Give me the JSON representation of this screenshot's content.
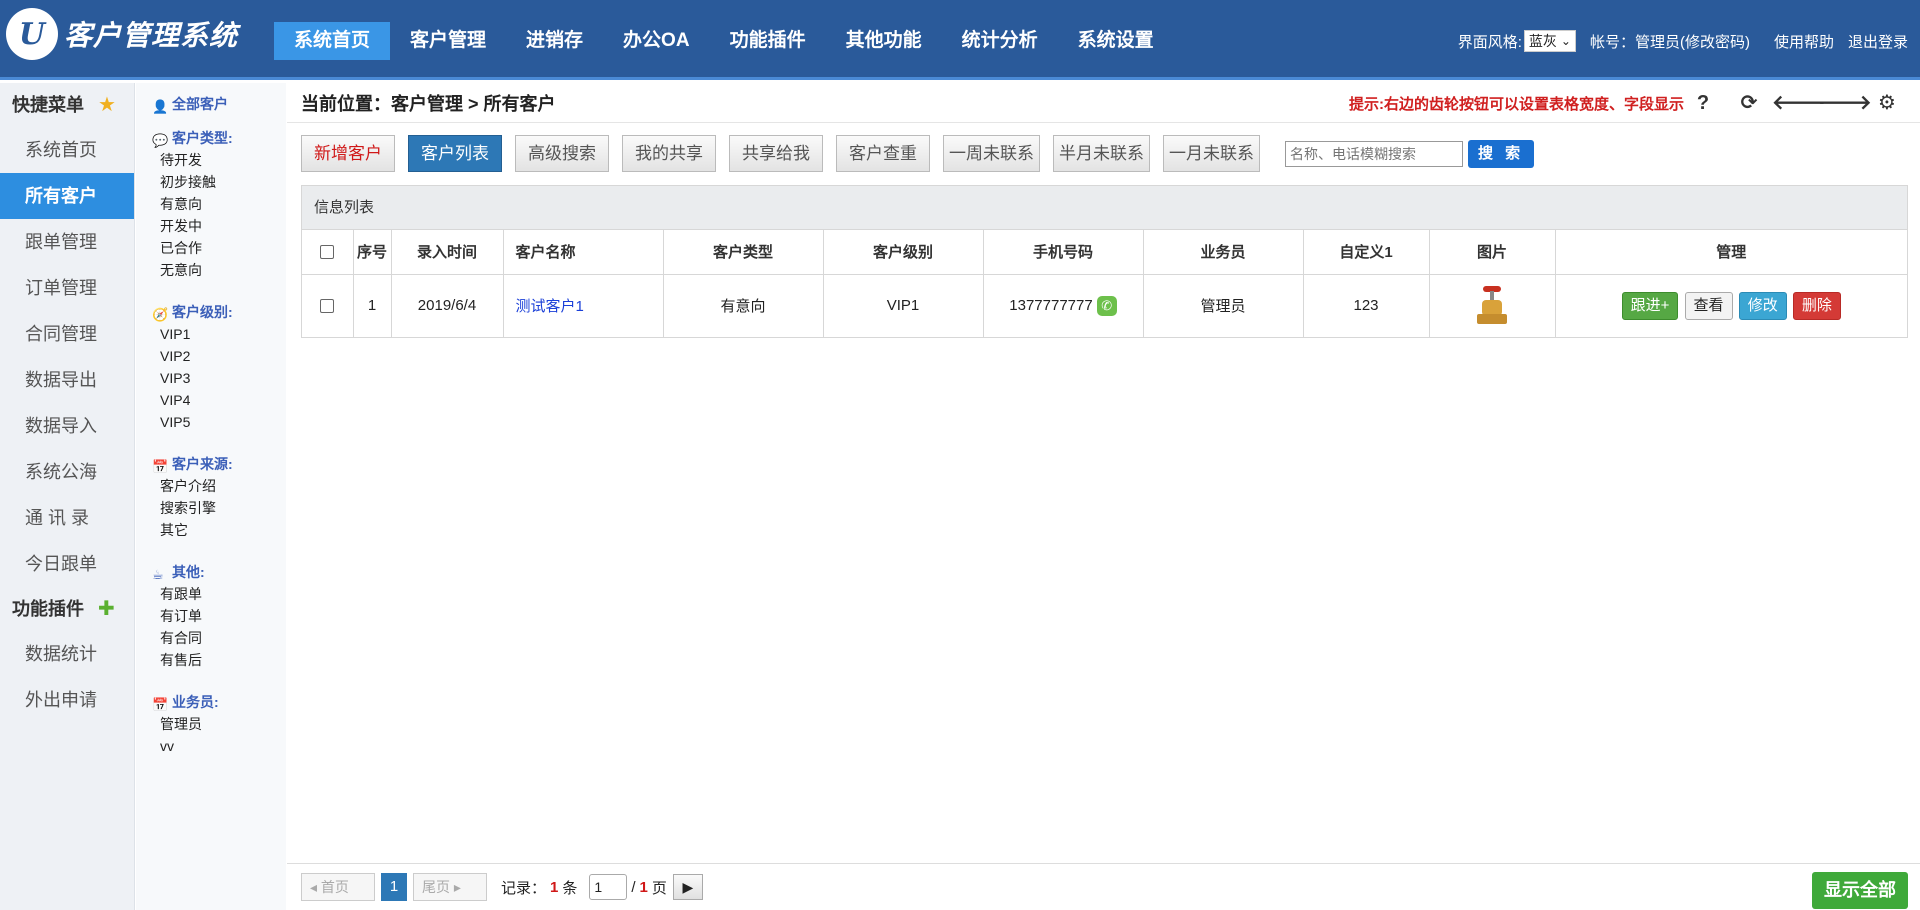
{
  "app": {
    "logo_letter": "U",
    "title": "客户管理系统"
  },
  "topnav": [
    "系统首页",
    "客户管理",
    "进销存",
    "办公OA",
    "功能插件",
    "其他功能",
    "统计分析",
    "系统设置"
  ],
  "topright": {
    "style_label": "界面风格:",
    "style_value": "蓝灰",
    "account": "帐号：管理员(修改密码)",
    "help": "使用帮助",
    "logout": "退出登录"
  },
  "leftmenu": {
    "quick_title": "快捷菜单",
    "items": [
      "系统首页",
      "所有客户",
      "跟单管理",
      "订单管理",
      "合同管理",
      "数据导出",
      "数据导入",
      "系统公海",
      "通 讯 录",
      "今日跟单"
    ],
    "plugin_title": "功能插件",
    "plugin_items": [
      "数据统计",
      "外出申请"
    ]
  },
  "categories": {
    "all": "全部客户",
    "type_title": "客户类型:",
    "types": [
      "待开发",
      "初步接触",
      "有意向",
      "开发中",
      "已合作",
      "无意向"
    ],
    "level_title": "客户级别:",
    "levels": [
      "VIP1",
      "VIP2",
      "VIP3",
      "VIP4",
      "VIP5"
    ],
    "source_title": "客户来源:",
    "sources": [
      "客户介绍",
      "搜索引擎",
      "其它"
    ],
    "other_title": "其他:",
    "others": [
      "有跟单",
      "有订单",
      "有合同",
      "有售后"
    ],
    "sales_title": "业务员:",
    "sales": [
      "管理员",
      "vv"
    ]
  },
  "breadcrumb": "当前位置：客户管理 > 所有客户",
  "hint": "提示:右边的齿轮按钮可以设置表格宽度、字段显示",
  "tools": [
    "?",
    "⟳",
    "🡐",
    "🡒",
    "⚙"
  ],
  "buttons": [
    "新增客户",
    "客户列表",
    "高级搜索",
    "我的共享",
    "共享给我",
    "客户查重",
    "一周未联系",
    "半月未联系",
    "一月未联系"
  ],
  "search": {
    "placeholder": "名称、电话模糊搜索",
    "button": "搜 索"
  },
  "list": {
    "title": "信息列表",
    "columns": [
      "序号",
      "录入时间",
      "客户名称",
      "客户类型",
      "客户级别",
      "手机号码",
      "业务员",
      "自定义1",
      "图片",
      "管理"
    ],
    "rows": [
      {
        "no": "1",
        "date": "2019/6/4",
        "name": "测试客户1",
        "type": "有意向",
        "level": "VIP1",
        "phone": "1377777777",
        "sales": "管理员",
        "custom1": "123"
      }
    ],
    "actions": [
      "跟进+",
      "查看",
      "修改",
      "删除"
    ]
  },
  "pager": {
    "first": "◂ 首页",
    "current": "1",
    "last": "尾页 ▸",
    "records_label": "记录：",
    "records": "1",
    "records_unit": "条",
    "page_input": "1",
    "page_sep": "/",
    "pages": "1",
    "pages_unit": "页",
    "go": "▶"
  },
  "show_all": "显示全部",
  "colors": {
    "header": "#2a5a9a",
    "active": "#2d8ee0",
    "hint": "#d02020"
  }
}
